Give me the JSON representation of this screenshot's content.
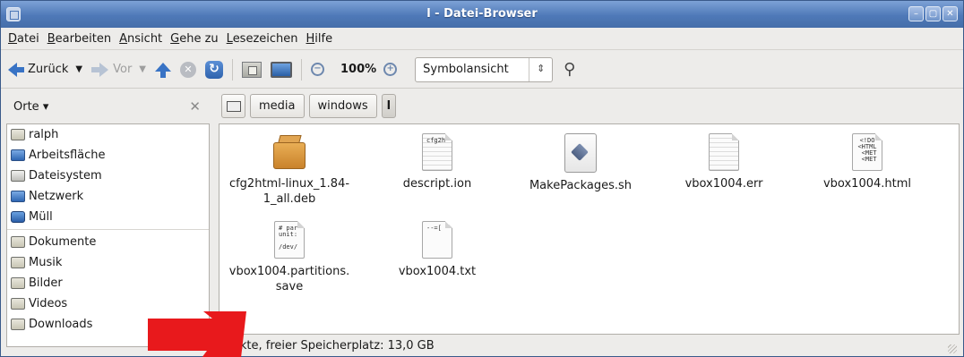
{
  "window": {
    "title": "l - Datei-Browser",
    "controls": [
      "minimize",
      "maximize",
      "close"
    ]
  },
  "menubar": {
    "items": [
      "Datei",
      "Bearbeiten",
      "Ansicht",
      "Gehe zu",
      "Lesezeichen",
      "Hilfe"
    ]
  },
  "toolbar": {
    "back_label": "Zurück",
    "forward_label": "Vor",
    "zoom_level": "100%",
    "view_mode": "Symbolansicht"
  },
  "sidebar": {
    "header": "Orte",
    "places": [
      {
        "label": "ralph",
        "icon": "home-folder-icon"
      },
      {
        "label": "Arbeitsfläche",
        "icon": "desktop-icon"
      },
      {
        "label": "Dateisystem",
        "icon": "filesystem-icon"
      },
      {
        "label": "Netzwerk",
        "icon": "network-icon"
      },
      {
        "label": "Müll",
        "icon": "trash-icon"
      }
    ],
    "bookmarks": [
      {
        "label": "Dokumente",
        "icon": "folder-icon"
      },
      {
        "label": "Musik",
        "icon": "folder-icon"
      },
      {
        "label": "Bilder",
        "icon": "folder-icon"
      },
      {
        "label": "Videos",
        "icon": "folder-icon"
      },
      {
        "label": "Downloads",
        "icon": "folder-icon"
      }
    ]
  },
  "pathbar": {
    "segments": [
      "media",
      "windows",
      "l"
    ]
  },
  "files": [
    {
      "name": "cfg2html-linux_1.84-1_all.deb",
      "line1": "cfg2html-linux_1.84-",
      "line2": "1_all.deb",
      "icon": "package-icon",
      "preview": ""
    },
    {
      "name": "descript.ion",
      "line1": "descript.ion",
      "line2": "",
      "icon": "text-file-icon",
      "preview": "cfg2h"
    },
    {
      "name": "MakePackages.sh",
      "line1": "MakePackages.sh",
      "line2": "",
      "icon": "script-icon",
      "preview": ""
    },
    {
      "name": "vbox1004.err",
      "line1": "vbox1004.err",
      "line2": "",
      "icon": "text-file-icon",
      "preview": ""
    },
    {
      "name": "vbox1004.html",
      "line1": "vbox1004.html",
      "line2": "",
      "icon": "html-file-icon",
      "preview": "<!DO\n<HTML\n <MET\n <MET"
    },
    {
      "name": "vbox1004.partitions.save",
      "line1": "vbox1004.partitions.",
      "line2": "save",
      "icon": "text-file-icon",
      "preview": "# par\nunit:\n\n/dev/"
    },
    {
      "name": "vbox1004.txt",
      "line1": "vbox1004.txt",
      "line2": "",
      "icon": "text-file-icon",
      "preview": "--=["
    }
  ],
  "statusbar": {
    "text": "bjekte, freier Speicherplatz: 13,0 GB"
  },
  "colors": {
    "titlebar": "#4f79b8",
    "annotation_arrow": "#e8191c"
  }
}
